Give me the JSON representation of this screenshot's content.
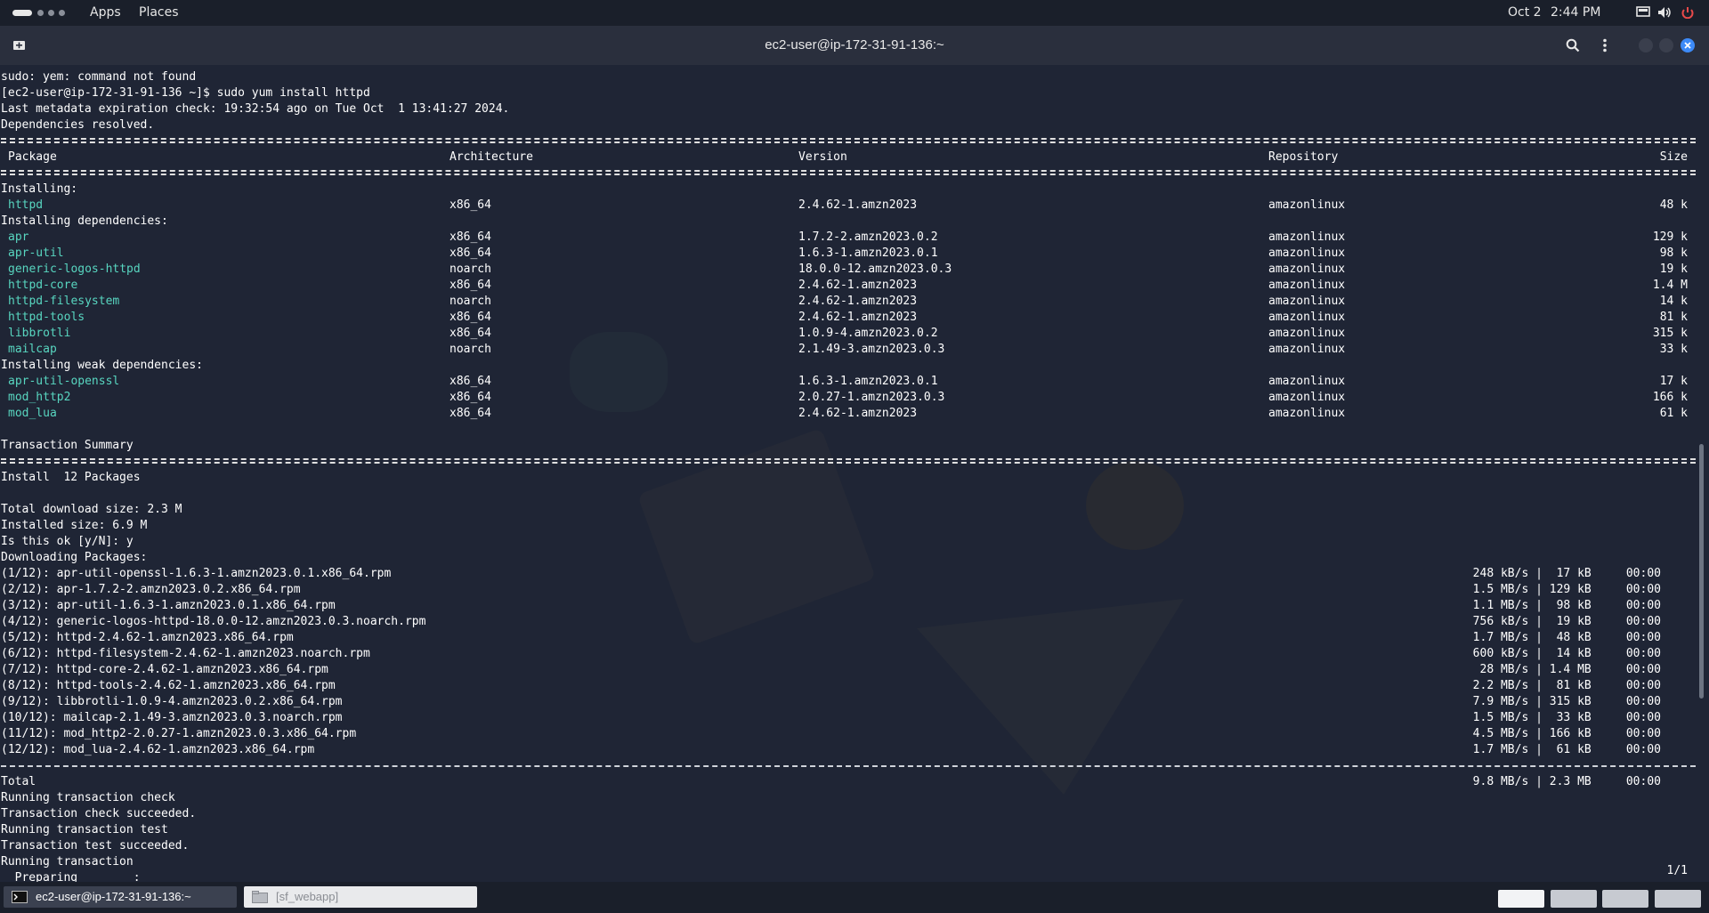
{
  "topbar": {
    "apps_label": "Apps",
    "places_label": "Places",
    "date": "Oct 2",
    "time": "2:44 PM"
  },
  "window": {
    "title": "ec2-user@ip-172-31-91-136:~"
  },
  "terminal": {
    "pre_lines": [
      "sudo: yem: command not found",
      "[ec2-user@ip-172-31-91-136 ~]$ sudo yum install httpd",
      "Last metadata expiration check: 19:32:54 ago on Tue Oct  1 13:41:27 2024.",
      "Dependencies resolved."
    ],
    "table_headers": [
      "Package",
      "Architecture",
      "Version",
      "Repository",
      "Size"
    ],
    "groups": [
      {
        "title": "Installing:",
        "rows": [
          [
            "httpd",
            "x86_64",
            "2.4.62-1.amzn2023",
            "amazonlinux",
            "48 k"
          ]
        ]
      },
      {
        "title": "Installing dependencies:",
        "rows": [
          [
            "apr",
            "x86_64",
            "1.7.2-2.amzn2023.0.2",
            "amazonlinux",
            "129 k"
          ],
          [
            "apr-util",
            "x86_64",
            "1.6.3-1.amzn2023.0.1",
            "amazonlinux",
            "98 k"
          ],
          [
            "generic-logos-httpd",
            "noarch",
            "18.0.0-12.amzn2023.0.3",
            "amazonlinux",
            "19 k"
          ],
          [
            "httpd-core",
            "x86_64",
            "2.4.62-1.amzn2023",
            "amazonlinux",
            "1.4 M"
          ],
          [
            "httpd-filesystem",
            "noarch",
            "2.4.62-1.amzn2023",
            "amazonlinux",
            "14 k"
          ],
          [
            "httpd-tools",
            "x86_64",
            "2.4.62-1.amzn2023",
            "amazonlinux",
            "81 k"
          ],
          [
            "libbrotli",
            "x86_64",
            "1.0.9-4.amzn2023.0.2",
            "amazonlinux",
            "315 k"
          ],
          [
            "mailcap",
            "noarch",
            "2.1.49-3.amzn2023.0.3",
            "amazonlinux",
            "33 k"
          ]
        ]
      },
      {
        "title": "Installing weak dependencies:",
        "rows": [
          [
            "apr-util-openssl",
            "x86_64",
            "1.6.3-1.amzn2023.0.1",
            "amazonlinux",
            "17 k"
          ],
          [
            "mod_http2",
            "x86_64",
            "2.0.27-1.amzn2023.0.3",
            "amazonlinux",
            "166 k"
          ],
          [
            "mod_lua",
            "x86_64",
            "2.4.62-1.amzn2023",
            "amazonlinux",
            "61 k"
          ]
        ]
      }
    ],
    "transaction_summary": "Transaction Summary",
    "install_line": "Install  12 Packages",
    "size_lines": [
      "Total download size: 2.3 M",
      "Installed size: 6.9 M",
      "Is this ok [y/N]: y",
      "Downloading Packages:"
    ],
    "downloads": [
      [
        "(1/12): apr-util-openssl-1.6.3-1.amzn2023.0.1.x86_64.rpm",
        "248 kB/s |  17 kB     00:00"
      ],
      [
        "(2/12): apr-1.7.2-2.amzn2023.0.2.x86_64.rpm",
        "1.5 MB/s | 129 kB     00:00"
      ],
      [
        "(3/12): apr-util-1.6.3-1.amzn2023.0.1.x86_64.rpm",
        "1.1 MB/s |  98 kB     00:00"
      ],
      [
        "(4/12): generic-logos-httpd-18.0.0-12.amzn2023.0.3.noarch.rpm",
        "756 kB/s |  19 kB     00:00"
      ],
      [
        "(5/12): httpd-2.4.62-1.amzn2023.x86_64.rpm",
        "1.7 MB/s |  48 kB     00:00"
      ],
      [
        "(6/12): httpd-filesystem-2.4.62-1.amzn2023.noarch.rpm",
        "600 kB/s |  14 kB     00:00"
      ],
      [
        "(7/12): httpd-core-2.4.62-1.amzn2023.x86_64.rpm",
        " 28 MB/s | 1.4 MB     00:00"
      ],
      [
        "(8/12): httpd-tools-2.4.62-1.amzn2023.x86_64.rpm",
        "2.2 MB/s |  81 kB     00:00"
      ],
      [
        "(9/12): libbrotli-1.0.9-4.amzn2023.0.2.x86_64.rpm",
        "7.9 MB/s | 315 kB     00:00"
      ],
      [
        "(10/12): mailcap-2.1.49-3.amzn2023.0.3.noarch.rpm",
        "1.5 MB/s |  33 kB     00:00"
      ],
      [
        "(11/12): mod_http2-2.0.27-1.amzn2023.0.3.x86_64.rpm",
        "4.5 MB/s | 166 kB     00:00"
      ],
      [
        "(12/12): mod_lua-2.4.62-1.amzn2023.x86_64.rpm",
        "1.7 MB/s |  61 kB     00:00"
      ]
    ],
    "total_label": "Total",
    "total_stats": "9.8 MB/s | 2.3 MB     00:00",
    "post_lines": [
      "Running transaction check",
      "Transaction check succeeded.",
      "Running transaction test",
      "Transaction test succeeded.",
      "Running transaction",
      "  Preparing        :"
    ],
    "preparing_progress": "1/1"
  },
  "taskbar": {
    "terminal_task": "ec2-user@ip-172-31-91-136:~",
    "files_task": "[sf_webapp]"
  },
  "colors": {
    "package_name": "#58d6c0",
    "close_button": "#3d8af7",
    "terminal_bg": "#1f2535"
  },
  "icons": [
    "new-tab-icon",
    "search-icon",
    "menu-kebab-icon",
    "close-icon",
    "display-icon",
    "volume-icon",
    "power-icon",
    "terminal-icon",
    "folder-icon"
  ]
}
